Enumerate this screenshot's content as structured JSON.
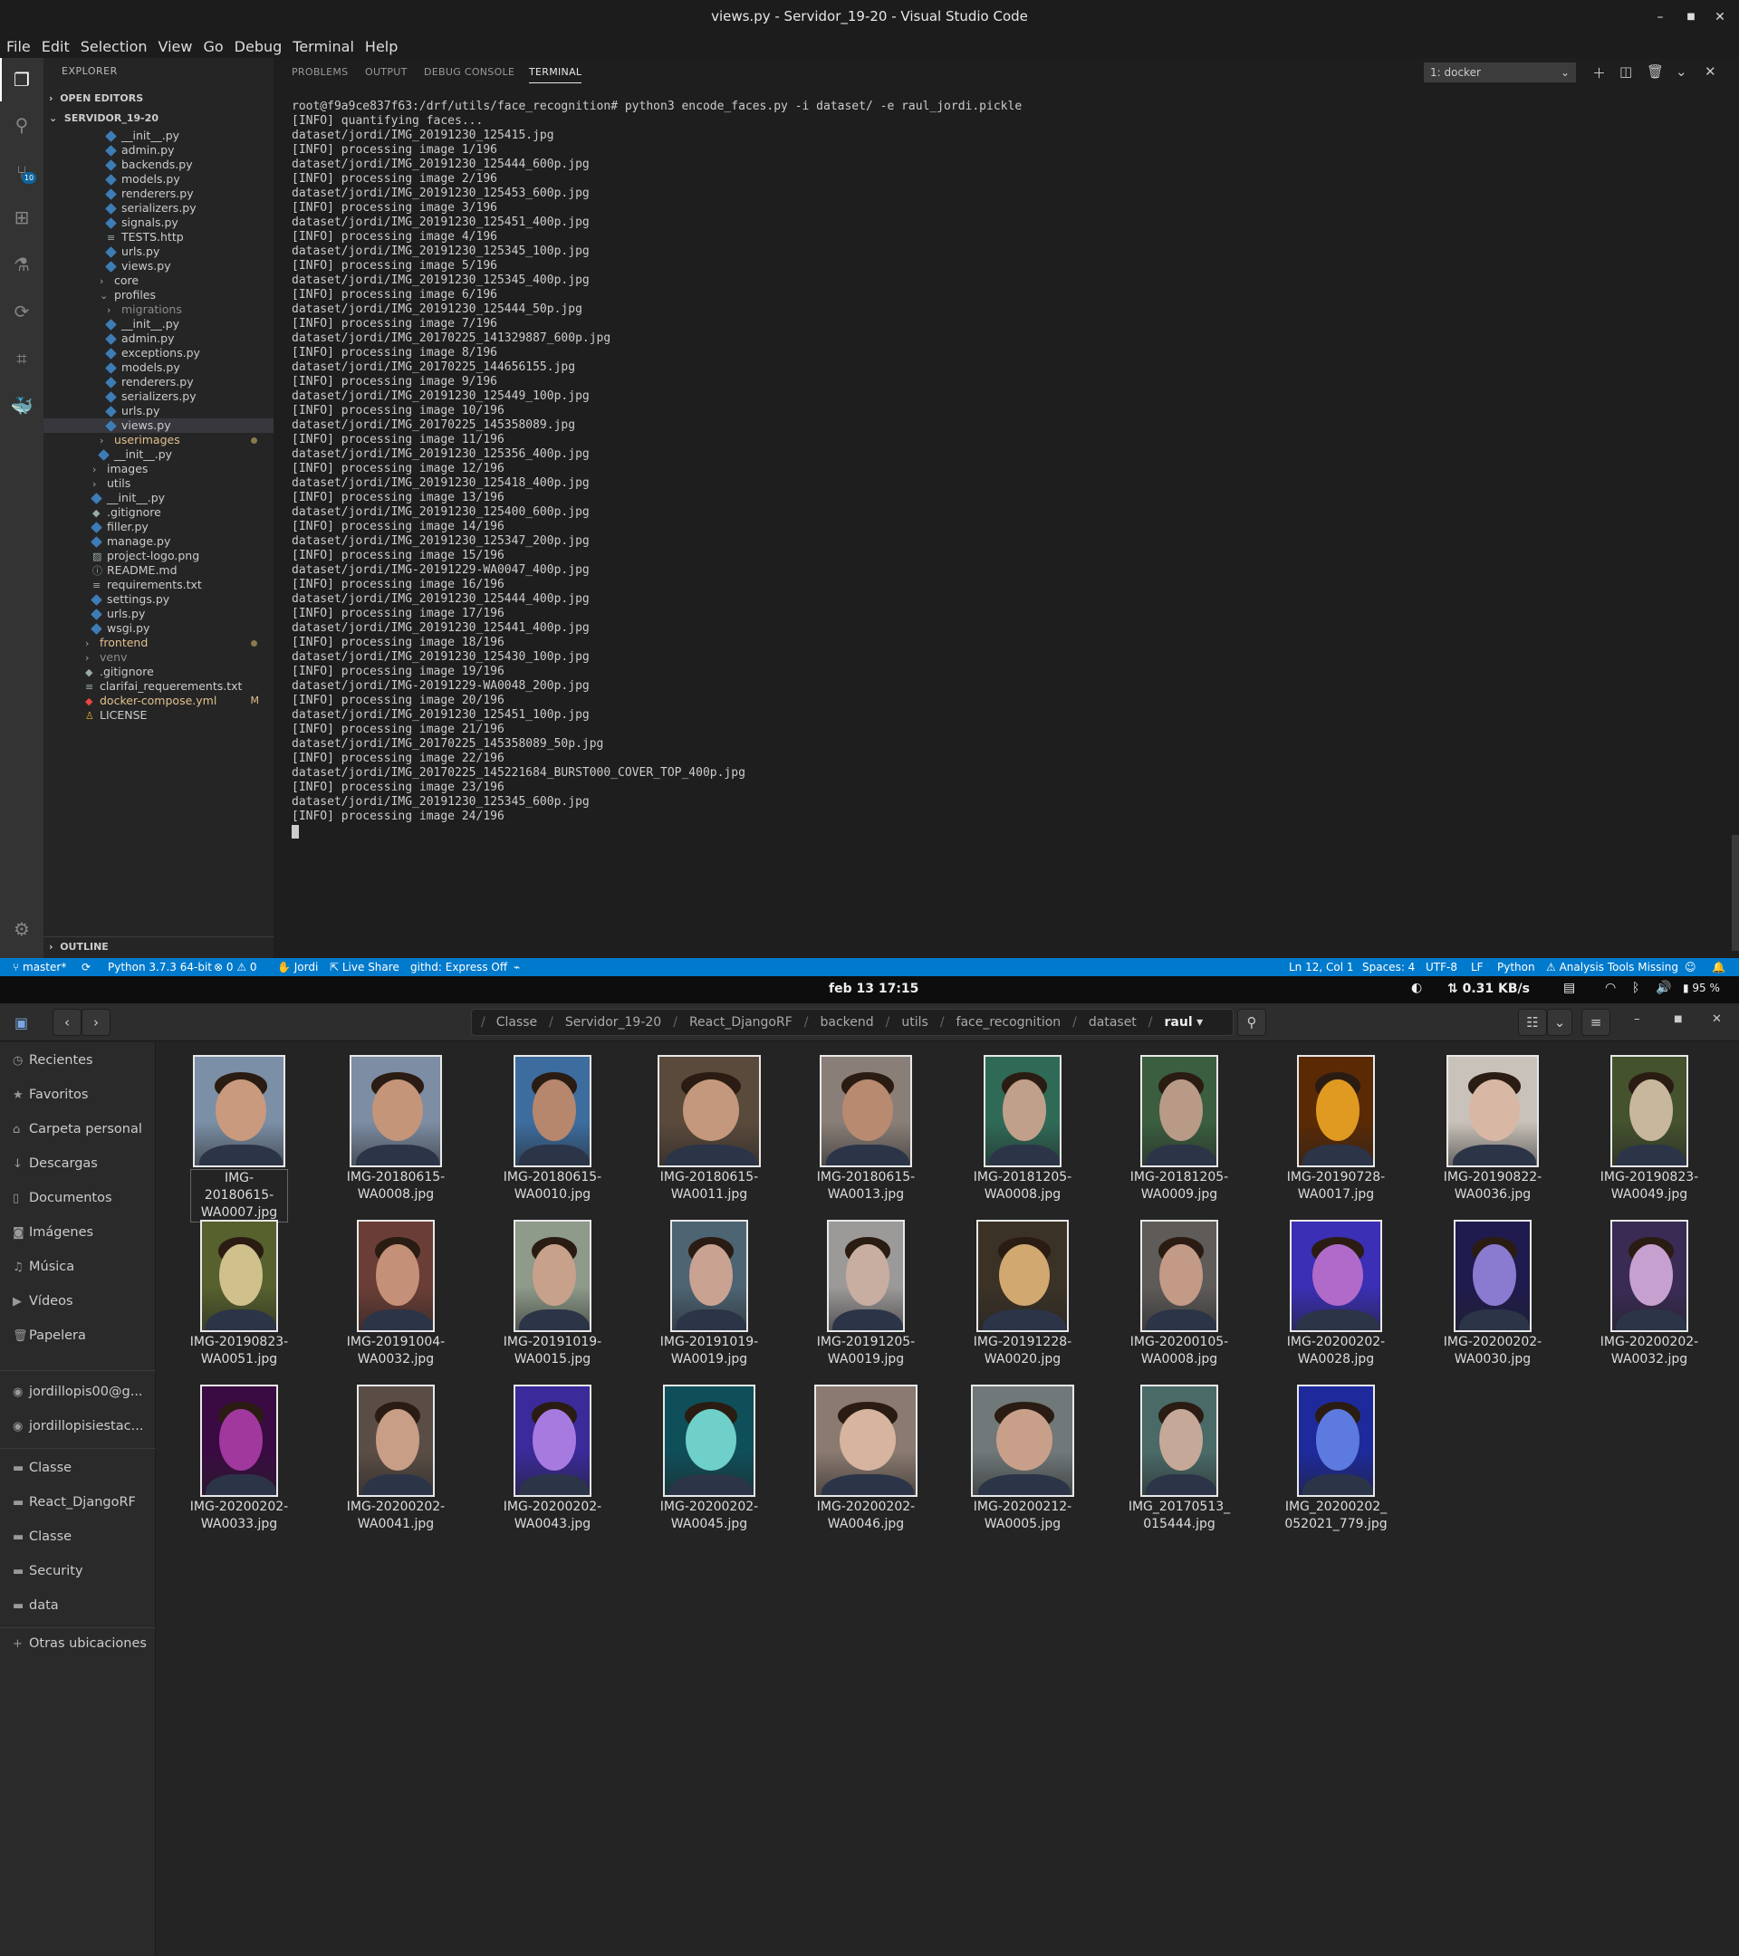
{
  "vscode": {
    "window_title": "views.py - Servidor_19-20 - Visual Studio Code",
    "menu": [
      "File",
      "Edit",
      "Selection",
      "View",
      "Go",
      "Debug",
      "Terminal",
      "Help"
    ],
    "scm_badge": "10",
    "explorer": {
      "header": "EXPLORER",
      "open_editors": "OPEN EDITORS",
      "project": "SERVIDOR_19-20",
      "outline": "OUTLINE",
      "rows": [
        {
          "label": "__init__.py",
          "indent": 48,
          "icon": "py"
        },
        {
          "label": "admin.py",
          "indent": 48,
          "icon": "py"
        },
        {
          "label": "backends.py",
          "indent": 48,
          "icon": "py"
        },
        {
          "label": "models.py",
          "indent": 48,
          "icon": "py"
        },
        {
          "label": "renderers.py",
          "indent": 48,
          "icon": "py"
        },
        {
          "label": "serializers.py",
          "indent": 48,
          "icon": "py"
        },
        {
          "label": "signals.py",
          "indent": 48,
          "icon": "py"
        },
        {
          "label": "TESTS.http",
          "indent": 48,
          "icon": "txt"
        },
        {
          "label": "urls.py",
          "indent": 48,
          "icon": "py"
        },
        {
          "label": "views.py",
          "indent": 48,
          "icon": "py"
        },
        {
          "label": "core",
          "indent": 40,
          "icon": "folder-closed"
        },
        {
          "label": "profiles",
          "indent": 40,
          "icon": "folder-open"
        },
        {
          "label": "migrations",
          "indent": 48,
          "icon": "folder-closed",
          "dim": true
        },
        {
          "label": "__init__.py",
          "indent": 48,
          "icon": "py"
        },
        {
          "label": "admin.py",
          "indent": 48,
          "icon": "py"
        },
        {
          "label": "exceptions.py",
          "indent": 48,
          "icon": "py"
        },
        {
          "label": "models.py",
          "indent": 48,
          "icon": "py"
        },
        {
          "label": "renderers.py",
          "indent": 48,
          "icon": "py"
        },
        {
          "label": "serializers.py",
          "indent": 48,
          "icon": "py"
        },
        {
          "label": "urls.py",
          "indent": 48,
          "icon": "py"
        },
        {
          "label": "views.py",
          "indent": 48,
          "icon": "py",
          "selected": true
        },
        {
          "label": "userimages",
          "indent": 40,
          "icon": "folder-closed",
          "modified": true
        },
        {
          "label": "__init__.py",
          "indent": 40,
          "icon": "py"
        },
        {
          "label": "images",
          "indent": 32,
          "icon": "folder-closed"
        },
        {
          "label": "utils",
          "indent": 32,
          "icon": "folder-closed"
        },
        {
          "label": "__init__.py",
          "indent": 32,
          "icon": "py"
        },
        {
          "label": ".gitignore",
          "indent": 32,
          "icon": "git"
        },
        {
          "label": "filler.py",
          "indent": 32,
          "icon": "py"
        },
        {
          "label": "manage.py",
          "indent": 32,
          "icon": "py"
        },
        {
          "label": "project-logo.png",
          "indent": 32,
          "icon": "img"
        },
        {
          "label": "README.md",
          "indent": 32,
          "icon": "info"
        },
        {
          "label": "requirements.txt",
          "indent": 32,
          "icon": "txt"
        },
        {
          "label": "settings.py",
          "indent": 32,
          "icon": "py"
        },
        {
          "label": "urls.py",
          "indent": 32,
          "icon": "py"
        },
        {
          "label": "wsgi.py",
          "indent": 32,
          "icon": "py"
        },
        {
          "label": "frontend",
          "indent": 24,
          "icon": "folder-closed",
          "modified": true
        },
        {
          "label": "venv",
          "indent": 24,
          "icon": "folder-closed",
          "dim": true
        },
        {
          "label": ".gitignore",
          "indent": 24,
          "icon": "git"
        },
        {
          "label": "clarifai_requerements.txt",
          "indent": 24,
          "icon": "txt"
        },
        {
          "label": "docker-compose.yml",
          "indent": 24,
          "icon": "yml",
          "badge": "M"
        },
        {
          "label": "LICENSE",
          "indent": 24,
          "icon": "license"
        }
      ]
    },
    "panel": {
      "tabs": [
        "PROBLEMS",
        "OUTPUT",
        "DEBUG CONSOLE",
        "TERMINAL"
      ],
      "active_tab": "TERMINAL",
      "terminal_select": "1: docker",
      "terminal_lines": [
        "root@f9a9ce837f63:/drf/utils/face_recognition# python3 encode_faces.py -i dataset/ -e raul_jordi.pickle",
        "[INFO] quantifying faces...",
        "dataset/jordi/IMG_20191230_125415.jpg",
        "[INFO] processing image 1/196",
        "dataset/jordi/IMG_20191230_125444_600p.jpg",
        "[INFO] processing image 2/196",
        "dataset/jordi/IMG_20191230_125453_600p.jpg",
        "[INFO] processing image 3/196",
        "dataset/jordi/IMG_20191230_125451_400p.jpg",
        "[INFO] processing image 4/196",
        "dataset/jordi/IMG_20191230_125345_100p.jpg",
        "[INFO] processing image 5/196",
        "dataset/jordi/IMG_20191230_125345_400p.jpg",
        "[INFO] processing image 6/196",
        "dataset/jordi/IMG_20191230_125444_50p.jpg",
        "[INFO] processing image 7/196",
        "dataset/jordi/IMG_20170225_141329887_600p.jpg",
        "[INFO] processing image 8/196",
        "dataset/jordi/IMG_20170225_144656155.jpg",
        "[INFO] processing image 9/196",
        "dataset/jordi/IMG_20191230_125449_100p.jpg",
        "[INFO] processing image 10/196",
        "dataset/jordi/IMG_20170225_145358089.jpg",
        "[INFO] processing image 11/196",
        "dataset/jordi/IMG_20191230_125356_400p.jpg",
        "[INFO] processing image 12/196",
        "dataset/jordi/IMG_20191230_125418_400p.jpg",
        "[INFO] processing image 13/196",
        "dataset/jordi/IMG_20191230_125400_600p.jpg",
        "[INFO] processing image 14/196",
        "dataset/jordi/IMG_20191230_125347_200p.jpg",
        "[INFO] processing image 15/196",
        "dataset/jordi/IMG-20191229-WA0047_400p.jpg",
        "[INFO] processing image 16/196",
        "dataset/jordi/IMG_20191230_125444_400p.jpg",
        "[INFO] processing image 17/196",
        "dataset/jordi/IMG_20191230_125441_400p.jpg",
        "[INFO] processing image 18/196",
        "dataset/jordi/IMG_20191230_125430_100p.jpg",
        "[INFO] processing image 19/196",
        "dataset/jordi/IMG-20191229-WA0048_200p.jpg",
        "[INFO] processing image 20/196",
        "dataset/jordi/IMG_20191230_125451_100p.jpg",
        "[INFO] processing image 21/196",
        "dataset/jordi/IMG_20170225_145358089_50p.jpg",
        "[INFO] processing image 22/196",
        "dataset/jordi/IMG_20170225_145221684_BURST000_COVER_TOP_400p.jpg",
        "[INFO] processing image 23/196",
        "dataset/jordi/IMG_20191230_125345_600p.jpg",
        "[INFO] processing image 24/196"
      ]
    },
    "status": {
      "branch": "master*",
      "python": "Python 3.7.3 64-bit",
      "errors": "0",
      "warnings": "0",
      "user": "Jordi",
      "live_share": "Live Share",
      "githd": "githd: Express Off",
      "position": "Ln 12, Col 1",
      "spaces": "Spaces: 4",
      "encoding": "UTF-8",
      "eol": "LF",
      "language": "Python",
      "analysis": "Analysis Tools Missing"
    }
  },
  "gnome": {
    "clock": "feb 13  17:15",
    "net_speed": "0.31 KB/s",
    "battery": "95 %"
  },
  "files": {
    "breadcrumbs": [
      "Classe",
      "Servidor_19-20",
      "React_DjangoRF",
      "backend",
      "utils",
      "face_recognition",
      "dataset",
      "raul"
    ],
    "sidebar": [
      {
        "label": "Recientes",
        "icon": "clock-icon"
      },
      {
        "label": "Favoritos",
        "icon": "star-icon"
      },
      {
        "label": "Carpeta personal",
        "icon": "home-icon"
      },
      {
        "label": "Descargas",
        "icon": "download-icon"
      },
      {
        "label": "Documentos",
        "icon": "document-icon"
      },
      {
        "label": "Imágenes",
        "icon": "camera-icon"
      },
      {
        "label": "Música",
        "icon": "music-icon"
      },
      {
        "label": "Vídeos",
        "icon": "video-icon"
      },
      {
        "label": "Papelera",
        "icon": "trash-icon"
      }
    ],
    "accounts": [
      "jordillopis00@g...",
      "jordillopisiestac..."
    ],
    "bookmarks": [
      "Classe",
      "React_DjangoRF",
      "Classe",
      "Security",
      "data"
    ],
    "other": "Otras ubicaciones",
    "thumbnails": [
      {
        "name": "IMG-20180615-WA0007.jpg",
        "line1": "IMG-20180615-",
        "line2": "WA0007.jpg",
        "bg": "#7b8fa6",
        "skin": "#c99a7e",
        "shape": "l"
      },
      {
        "name": "IMG-20180615-WA0008.jpg",
        "line1": "IMG-20180615-",
        "line2": "WA0008.jpg",
        "bg": "#7d8da3",
        "skin": "#c49579",
        "shape": "l"
      },
      {
        "name": "IMG-20180615-WA0010.jpg",
        "line1": "IMG-20180615-",
        "line2": "WA0010.jpg",
        "bg": "#3d6d9f",
        "skin": "#b6876c",
        "shape": "m"
      },
      {
        "name": "IMG-20180615-WA0011.jpg",
        "line1": "IMG-20180615-",
        "line2": "WA0011.jpg",
        "bg": "#5a4a3c",
        "skin": "#c4987c",
        "shape": "w"
      },
      {
        "name": "IMG-20180615-WA0013.jpg",
        "line1": "IMG-20180615-",
        "line2": "WA0013.jpg",
        "bg": "#8a7f78",
        "skin": "#b88a70",
        "shape": "l"
      },
      {
        "name": "IMG-20181205-WA0008.jpg",
        "line1": "IMG-20181205-",
        "line2": "WA0008.jpg",
        "bg": "#2f6a57",
        "skin": "#c0a08a",
        "shape": "m"
      },
      {
        "name": "IMG-20181205-WA0009.jpg",
        "line1": "IMG-20181205-",
        "line2": "WA0009.jpg",
        "bg": "#3a5e3f",
        "skin": "#b89a86",
        "shape": "m"
      },
      {
        "name": "IMG-20190728-WA0017.jpg",
        "line1": "IMG-20190728-",
        "line2": "WA0017.jpg",
        "bg": "#5a2a05",
        "skin": "#e09a22",
        "shape": "m"
      },
      {
        "name": "IMG-20190822-WA0036.jpg",
        "line1": "IMG-20190822-",
        "line2": "WA0036.jpg",
        "bg": "#c9c2ba",
        "skin": "#d8b8a4",
        "shape": "l"
      },
      {
        "name": "IMG-20190823-WA0049.jpg",
        "line1": "IMG-20190823-",
        "line2": "WA0049.jpg",
        "bg": "#44522e",
        "skin": "#c8b79c",
        "shape": "m"
      },
      {
        "name": "IMG-20190823-WA0051.jpg",
        "line1": "IMG-20190823-",
        "line2": "WA0051.jpg",
        "bg": "#56612e",
        "skin": "#cfc08c",
        "shape": "m"
      },
      {
        "name": "IMG-20191004-WA0032.jpg",
        "line1": "IMG-20191004-",
        "line2": "WA0032.jpg",
        "bg": "#6a3e36",
        "skin": "#c49078",
        "shape": "m"
      },
      {
        "name": "IMG-20191019-WA0015.jpg",
        "line1": "IMG-20191019-",
        "line2": "WA0015.jpg",
        "bg": "#8e9a8a",
        "skin": "#c8a18a",
        "shape": "m"
      },
      {
        "name": "IMG-20191019-WA0019.jpg",
        "line1": "IMG-20191019-",
        "line2": "WA0019.jpg",
        "bg": "#4d6473",
        "skin": "#c9a292",
        "shape": "m"
      },
      {
        "name": "IMG-20191205-WA0019.jpg",
        "line1": "IMG-20191205-",
        "line2": "WA0019.jpg",
        "bg": "#9c9a99",
        "skin": "#c8aea0",
        "shape": "m"
      },
      {
        "name": "IMG-20191228-WA0020.jpg",
        "line1": "IMG-20191228-",
        "line2": "WA0020.jpg",
        "bg": "#3b3226",
        "skin": "#d1a870",
        "shape": "l"
      },
      {
        "name": "IMG-20200105-WA0008.jpg",
        "line1": "IMG-20200105-",
        "line2": "WA0008.jpg",
        "bg": "#5e5b59",
        "skin": "#c29a86",
        "shape": "m"
      },
      {
        "name": "IMG-20200202-WA0028.jpg",
        "line1": "IMG-20200202-",
        "line2": "WA0028.jpg",
        "bg": "#3b2fb5",
        "skin": "#b06ac9",
        "shape": "l"
      },
      {
        "name": "IMG-20200202-WA0030.jpg",
        "line1": "IMG-20200202-",
        "line2": "WA0030.jpg",
        "bg": "#1f1b4e",
        "skin": "#8a7bd0",
        "shape": "m"
      },
      {
        "name": "IMG-20200202-WA0032.jpg",
        "line1": "IMG-20200202-",
        "line2": "WA0032.jpg",
        "bg": "#3a2b55",
        "skin": "#c6a0cf",
        "shape": "m"
      },
      {
        "name": "IMG-20200202-WA0033.jpg",
        "line1": "IMG-20200202-",
        "line2": "WA0033.jpg",
        "bg": "#3a0b42",
        "skin": "#a1389e",
        "shape": "m"
      },
      {
        "name": "IMG-20200202-WA0041.jpg",
        "line1": "IMG-20200202-",
        "line2": "WA0041.jpg",
        "bg": "#5a4d45",
        "skin": "#c99e86",
        "shape": "m"
      },
      {
        "name": "IMG-20200202-WA0043.jpg",
        "line1": "IMG-20200202-",
        "line2": "WA0043.jpg",
        "bg": "#3a2a9a",
        "skin": "#a77ae0",
        "shape": "m"
      },
      {
        "name": "IMG-20200202-WA0045.jpg",
        "line1": "IMG-20200202-",
        "line2": "WA0045.jpg",
        "bg": "#0f4f5a",
        "skin": "#6ed0c8",
        "shape": "l"
      },
      {
        "name": "IMG-20200202-WA0046.jpg",
        "line1": "IMG-20200202-",
        "line2": "WA0046.jpg",
        "bg": "#8a7a70",
        "skin": "#d6b4a0",
        "shape": "w"
      },
      {
        "name": "IMG-20200212-WA0005.jpg",
        "line1": "IMG-20200212-",
        "line2": "WA0005.jpg",
        "bg": "#707879",
        "skin": "#c8a08a",
        "shape": "w"
      },
      {
        "name": "IMG_20170513_015444.jpg",
        "line1": "IMG_20170513_",
        "line2": "015444.jpg",
        "bg": "#4a6a68",
        "skin": "#c6a898",
        "shape": "m"
      },
      {
        "name": "IMG_20200202_052021_779.jpg",
        "line1": "IMG_20200202_",
        "line2": "052021_779.jpg",
        "bg": "#1e2a9c",
        "skin": "#5c7ae0",
        "shape": "m"
      }
    ]
  }
}
